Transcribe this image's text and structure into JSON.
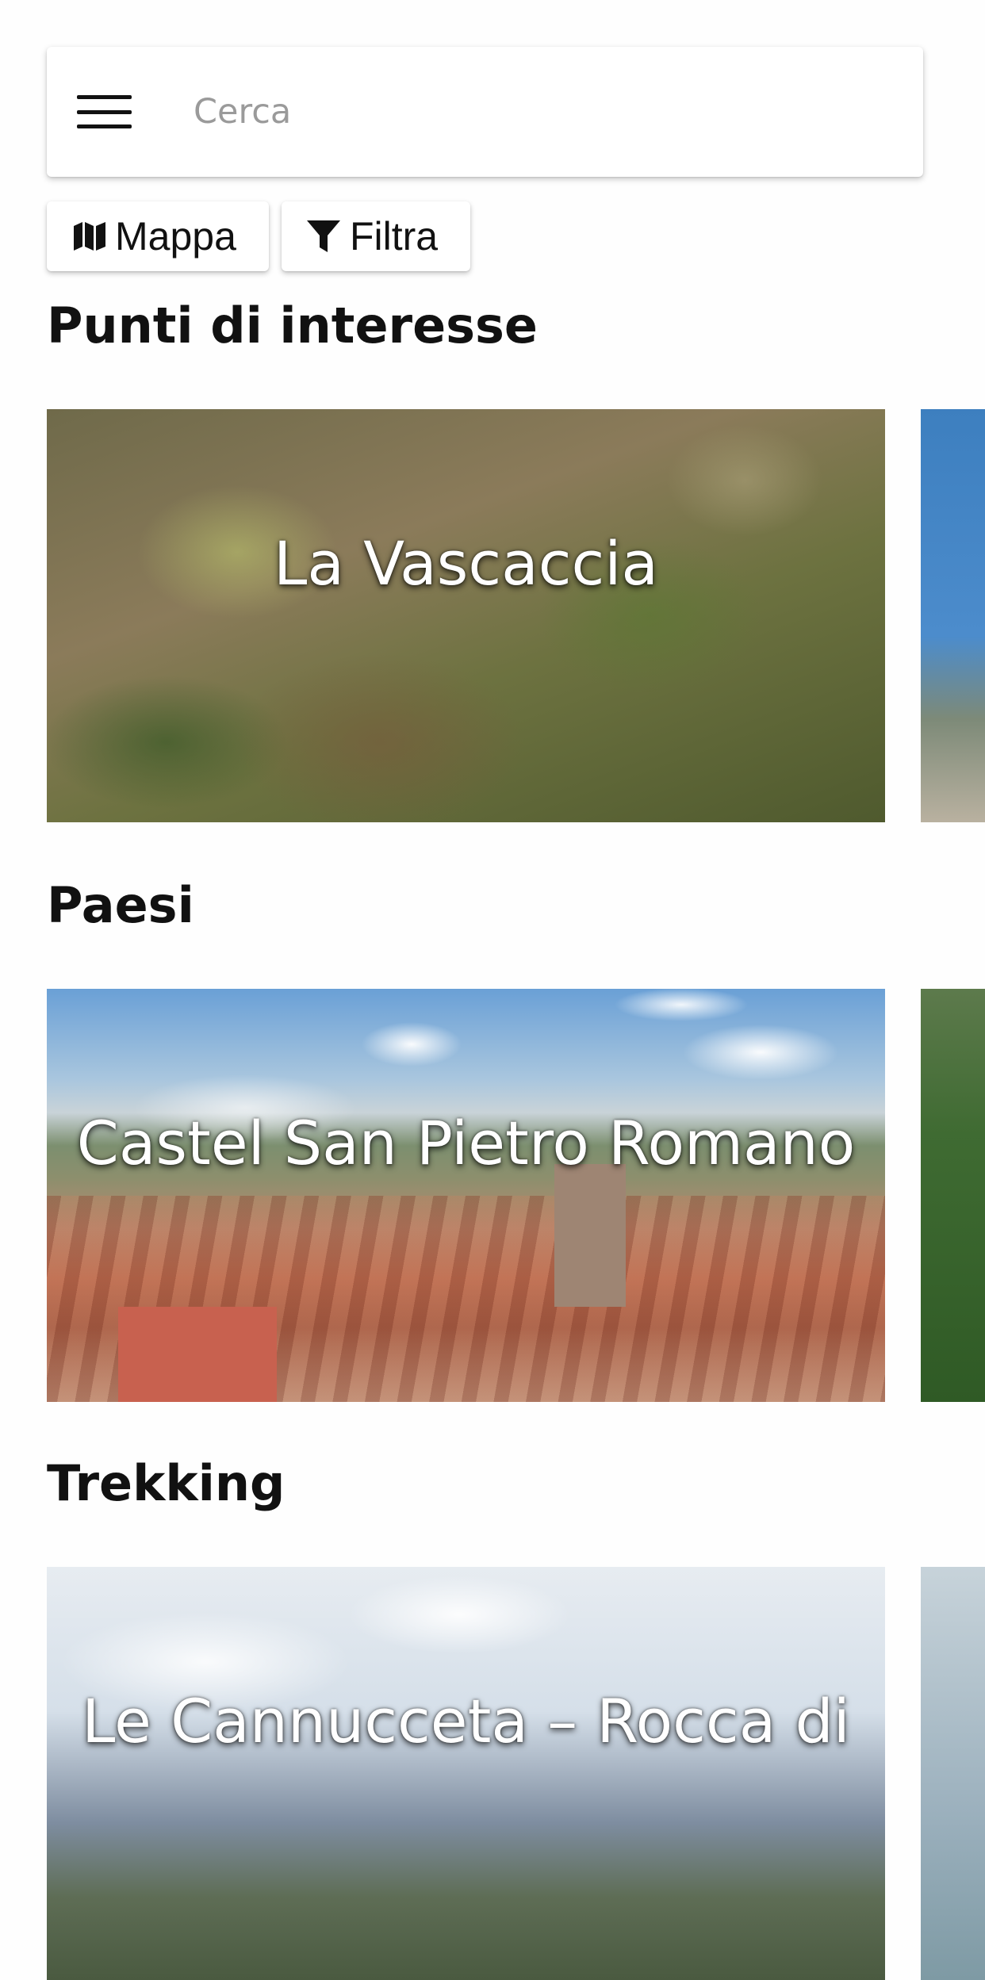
{
  "search": {
    "placeholder": "Cerca",
    "value": ""
  },
  "actions": {
    "map_label": "Mappa",
    "filter_label": "Filtra"
  },
  "icons": {
    "menu": "hamburger-menu-icon",
    "map": "map-icon",
    "filter": "filter-funnel-icon"
  },
  "sections": [
    {
      "title": "Punti di interesse",
      "cards": [
        {
          "label": "La Vascaccia"
        },
        {
          "label": ""
        }
      ]
    },
    {
      "title": "Paesi",
      "cards": [
        {
          "label": "Castel San Pietro Romano"
        },
        {
          "label": ""
        }
      ]
    },
    {
      "title": "Trekking",
      "cards": [
        {
          "label": "Le Cannucceta – Rocca di"
        },
        {
          "label": ""
        }
      ]
    }
  ]
}
